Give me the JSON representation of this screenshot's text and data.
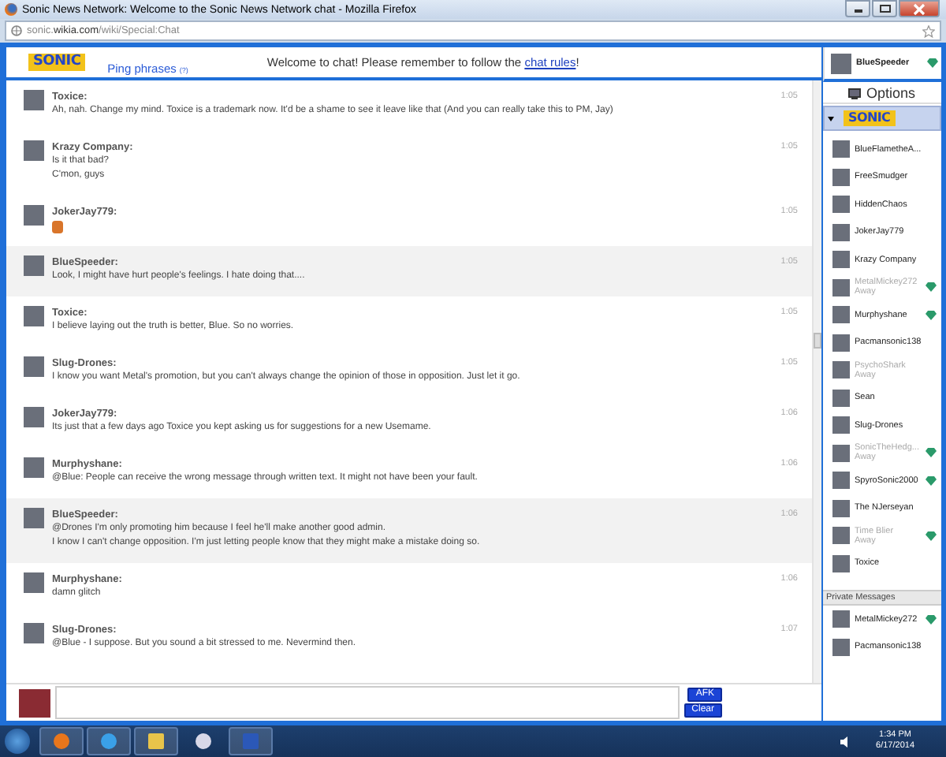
{
  "window": {
    "title": "Sonic News Network: Welcome to the Sonic News Network chat - Mozilla Firefox"
  },
  "address_bar": {
    "url": "sonic.**wikia.com**/wiki/Special:Chat"
  },
  "chat_header": {
    "logo": "SONIC",
    "ping_phrases": "Ping phrases",
    "ping_hint": "(?)",
    "welcome_before": "Welcome to chat! Please remember to follow the ",
    "welcome_link": "chat rules",
    "welcome_after": "!"
  },
  "current_user": {
    "name": "BlueSpeeder",
    "moderator": true
  },
  "messages": [
    {
      "user": "Toxice:",
      "lines": [
        "Ah, nah. Change my mind. Toxice is a trademark now. It'd be a shame to see it leave like that (And you can really take this to PM, Jay)"
      ],
      "time": "1:05",
      "highlighted": false
    },
    {
      "user": "Krazy Company:",
      "lines": [
        "Is it that bad?",
        "C'mon, guys"
      ],
      "time": "1:05",
      "highlighted": false
    },
    {
      "user": "JokerJay779:",
      "emoticon": true,
      "time": "1:05",
      "highlighted": false
    },
    {
      "user": "BlueSpeeder:",
      "lines": [
        "Look, I might have hurt people's feelings. I hate doing that...."
      ],
      "time": "1:05",
      "highlighted": true
    },
    {
      "user": "Toxice:",
      "lines": [
        "I believe laying out the truth is better, Blue. So no worries."
      ],
      "time": "1:05",
      "highlighted": false
    },
    {
      "user": "Slug-Drones:",
      "lines": [
        "I know you want Metal's promotion, but you can't always change the opinion of those in opposition. Just let it go."
      ],
      "time": "1:05",
      "highlighted": false
    },
    {
      "user": "JokerJay779:",
      "lines": [
        "Its just that a few days ago Toxice you kept asking us for suggestions for a new Usemame."
      ],
      "time": "1:06",
      "highlighted": false
    },
    {
      "user": "Murphyshane:",
      "lines": [
        "@Blue: People can receive the wrong message through written text. It might not have been your fault."
      ],
      "time": "1:06",
      "highlighted": false
    },
    {
      "user": "BlueSpeeder:",
      "lines": [
        "@Drones I'm only promoting him because I feel he'll make another good admin.",
        "I know I can't change opposition. I'm just letting people know that they might make a mistake doing so."
      ],
      "time": "1:06",
      "highlighted": true
    },
    {
      "user": "Murphyshane:",
      "lines": [
        "damn glitch"
      ],
      "time": "1:06",
      "highlighted": false
    },
    {
      "user": "Slug-Drones:",
      "lines": [
        "@Blue - I suppose. But you sound a bit stressed to me. Nevermind then."
      ],
      "time": "1:07",
      "highlighted": false
    }
  ],
  "composer": {
    "afk": "AFK",
    "clear": "Clear"
  },
  "sidebar": {
    "options": "Options",
    "logo": "SONIC",
    "users": [
      {
        "name": "BlueFlametheA...",
        "away": false,
        "moderator": false
      },
      {
        "name": "FreeSmudger",
        "away": false,
        "moderator": false
      },
      {
        "name": "HiddenChaos",
        "away": false,
        "moderator": false
      },
      {
        "name": "JokerJay779",
        "away": false,
        "moderator": false
      },
      {
        "name": "Krazy Company",
        "away": false,
        "moderator": false
      },
      {
        "name": "MetalMickey272",
        "away": true,
        "status": "Away",
        "moderator": true
      },
      {
        "name": "Murphyshane",
        "away": false,
        "moderator": true
      },
      {
        "name": "Pacmansonic138",
        "away": false,
        "moderator": false
      },
      {
        "name": "PsychoShark",
        "away": true,
        "status": "Away",
        "moderator": false
      },
      {
        "name": "Sean",
        "away": false,
        "moderator": false
      },
      {
        "name": "Slug-Drones",
        "away": false,
        "moderator": false
      },
      {
        "name": "SonicTheHedg...",
        "away": true,
        "status": "Away",
        "moderator": true
      },
      {
        "name": "SpyroSonic2000",
        "away": false,
        "moderator": true
      },
      {
        "name": "The NJerseyan",
        "away": false,
        "moderator": false
      },
      {
        "name": "Time Blier",
        "away": true,
        "status": "Away",
        "moderator": true
      },
      {
        "name": "Toxice",
        "away": false,
        "moderator": false
      }
    ],
    "private_title": "Private Messages",
    "private": [
      {
        "name": "MetalMickey272",
        "moderator": true
      },
      {
        "name": "Pacmansonic138",
        "moderator": false
      }
    ]
  },
  "taskbar": {
    "time": "1:34 PM",
    "date": "6/17/2014"
  }
}
